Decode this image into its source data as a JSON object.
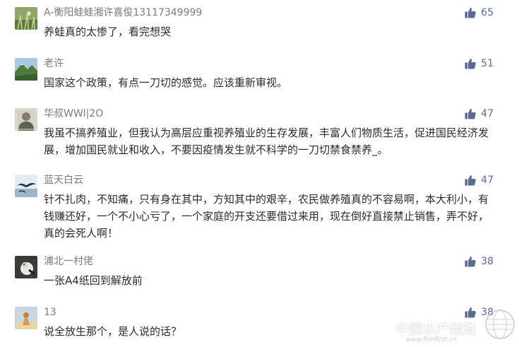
{
  "comments": [
    {
      "name": "A-衡阳蛙蛙湘许喜俊13117349999",
      "text": "养蛙真的太惨了，看完想哭",
      "likes": "65",
      "avatar": "grass-avatar"
    },
    {
      "name": "老许",
      "text": "国家这个政策，有点一刀切的感觉。应该重新审视。",
      "likes": "51",
      "avatar": "mountain-avatar"
    },
    {
      "name": "华叔WWl|2O",
      "text": "我虽不搞养殖业，但我认为高层应重视养殖业的生存发展，丰富人们物质生活，促进国民经济发展，增加国民就业和收入，不要因疫情发生就不科学的一刀切禁食禁养_。",
      "likes": "47",
      "avatar": "portrait-avatar"
    },
    {
      "name": "蓝天白云",
      "text": "针不扎肉，不知痛，只有身在其中，方知其中的艰辛，农民做养殖真的不容易啊，本大利小，有钱赚还好，一个不小心亏了，一个家庭的开支还要借过来用，现在倒好直接禁止销售，弄不好，真的会死人啊！",
      "likes": "47",
      "avatar": "seabird-avatar"
    },
    {
      "name": "浦北一村佬",
      "text": "一张A4纸回到解放前",
      "likes": "38",
      "avatar": "bird-avatar"
    },
    {
      "name": "13",
      "text": "说全放生那个，是人说的话？",
      "likes": "38",
      "avatar": "figure-avatar"
    }
  ],
  "watermark": {
    "title": "中国水产频道",
    "url": "www.fishfirst.cn"
  },
  "colors": {
    "name": "#7b7b7b",
    "text": "#2b2b2b",
    "like": "#576b95"
  },
  "icons": {
    "like": "thumbs-up-icon"
  }
}
